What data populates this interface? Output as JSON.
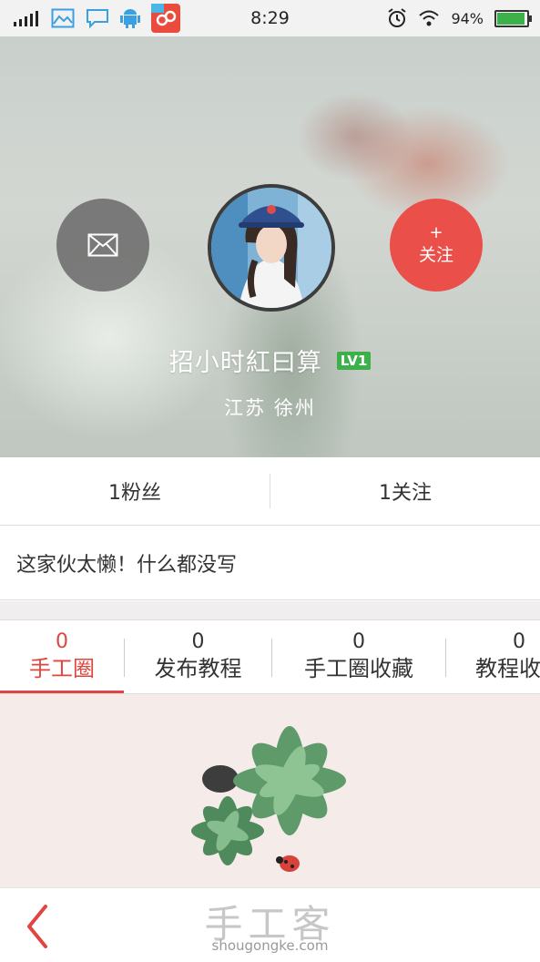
{
  "status_bar": {
    "time": "8:29",
    "battery_percent": "94%",
    "battery_level": 0.94,
    "icons": [
      "signal-icon",
      "gallery-icon",
      "chat-icon",
      "android-icon",
      "app-icon",
      "alarm-icon",
      "wifi-icon",
      "battery-icon"
    ]
  },
  "profile": {
    "message_icon": "envelope-icon",
    "follow_label": "关注",
    "follow_plus": "+",
    "username": "招小时紅曰算",
    "level": "LV1",
    "location": "江苏 徐州"
  },
  "stats": {
    "fans": "1粉丝",
    "following": "1关注"
  },
  "bio": "这家伙太懒！什么都没写",
  "tabs": [
    {
      "count": "0",
      "label": "手工圈",
      "active": true
    },
    {
      "count": "0",
      "label": "发布教程",
      "active": false
    },
    {
      "count": "0",
      "label": "手工圈收藏",
      "active": false
    },
    {
      "count": "0",
      "label": "教程收藏",
      "active": false
    }
  ],
  "footer": {
    "brand": "手工客",
    "url": "shougongke.com"
  },
  "colors": {
    "accent": "#e0463f",
    "follow_button": "#ea4f4a",
    "level_badge": "#3cb14a"
  }
}
